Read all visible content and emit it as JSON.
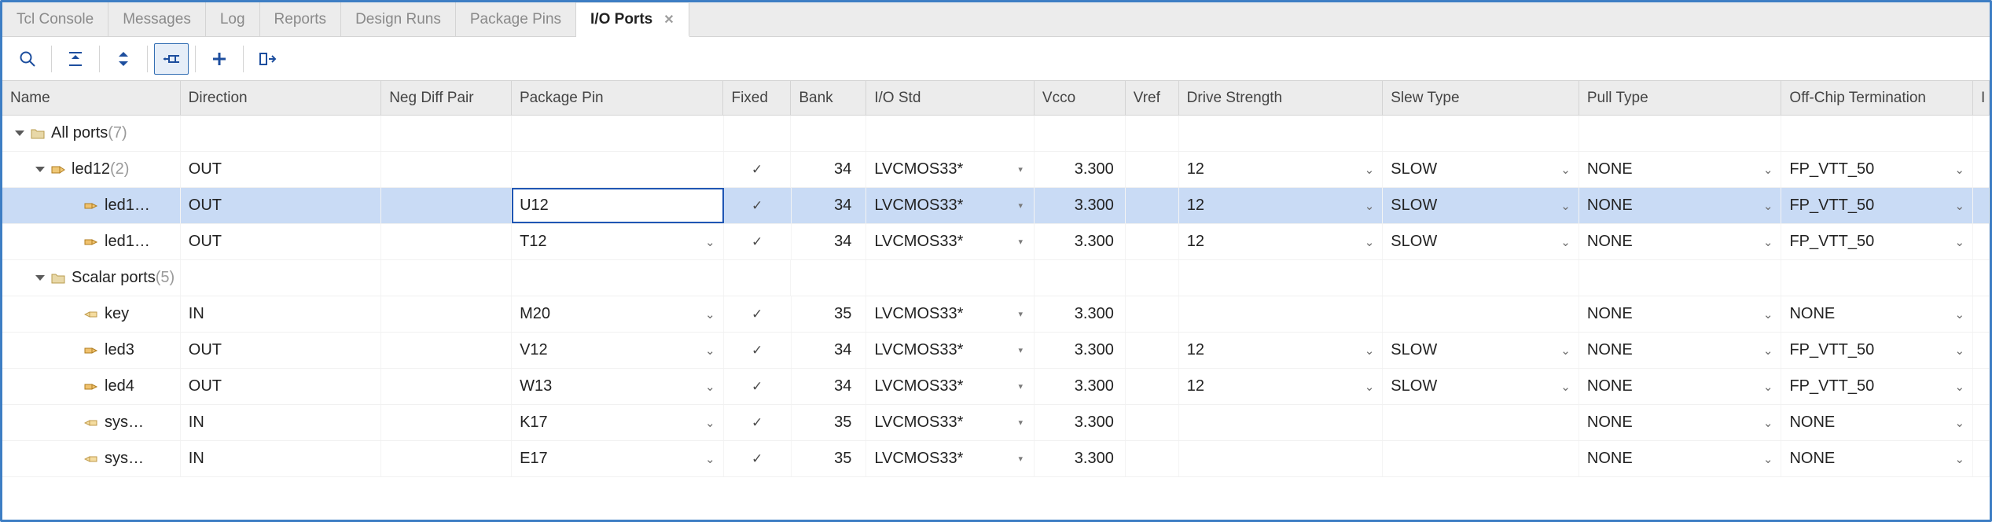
{
  "tabs": {
    "items": [
      "Tcl Console",
      "Messages",
      "Log",
      "Reports",
      "Design Runs",
      "Package Pins",
      "I/O Ports"
    ],
    "activeIndex": 6
  },
  "columns": {
    "name": "Name",
    "direction": "Direction",
    "neg": "Neg Diff Pair",
    "pkg": "Package Pin",
    "fixed": "Fixed",
    "bank": "Bank",
    "io": "I/O Std",
    "vcco": "Vcco",
    "vref": "Vref",
    "drive": "Drive Strength",
    "slew": "Slew Type",
    "pull": "Pull Type",
    "off": "Off-Chip Termination",
    "last": "I"
  },
  "tree": {
    "root": {
      "label": "All ports",
      "count": "(7)"
    },
    "groups": [
      {
        "type": "bus",
        "label": "led12",
        "count": "(2)",
        "dir": "OUT",
        "pkg": "",
        "fixed": true,
        "bank": "34",
        "io": "LVCMOS33*",
        "vcco": "3.300",
        "drive": "12",
        "slew": "SLOW",
        "pull": "NONE",
        "off": "FP_VTT_50",
        "children": [
          {
            "selected": true,
            "icon": "out",
            "label": "led1…",
            "dir": "OUT",
            "pkg": "U12",
            "fixed": true,
            "bank": "34",
            "io": "LVCMOS33*",
            "vcco": "3.300",
            "drive": "12",
            "slew": "SLOW",
            "pull": "NONE",
            "off": "FP_VTT_50"
          },
          {
            "icon": "out",
            "label": "led1…",
            "dir": "OUT",
            "pkg": "T12",
            "fixed": true,
            "bank": "34",
            "io": "LVCMOS33*",
            "vcco": "3.300",
            "drive": "12",
            "slew": "SLOW",
            "pull": "NONE",
            "off": "FP_VTT_50"
          }
        ]
      },
      {
        "type": "folder",
        "label": "Scalar ports",
        "count": "(5)",
        "children": [
          {
            "icon": "in",
            "label": "key",
            "dir": "IN",
            "pkg": "M20",
            "fixed": true,
            "bank": "35",
            "io": "LVCMOS33*",
            "vcco": "3.300",
            "drive": "",
            "slew": "",
            "pull": "NONE",
            "off": "NONE"
          },
          {
            "icon": "out",
            "label": "led3",
            "dir": "OUT",
            "pkg": "V12",
            "fixed": true,
            "bank": "34",
            "io": "LVCMOS33*",
            "vcco": "3.300",
            "drive": "12",
            "slew": "SLOW",
            "pull": "NONE",
            "off": "FP_VTT_50"
          },
          {
            "icon": "out",
            "label": "led4",
            "dir": "OUT",
            "pkg": "W13",
            "fixed": true,
            "bank": "34",
            "io": "LVCMOS33*",
            "vcco": "3.300",
            "drive": "12",
            "slew": "SLOW",
            "pull": "NONE",
            "off": "FP_VTT_50"
          },
          {
            "icon": "in",
            "label": "sys…",
            "dir": "IN",
            "pkg": "K17",
            "fixed": true,
            "bank": "35",
            "io": "LVCMOS33*",
            "vcco": "3.300",
            "drive": "",
            "slew": "",
            "pull": "NONE",
            "off": "NONE"
          },
          {
            "icon": "in",
            "label": "sys…",
            "dir": "IN",
            "pkg": "E17",
            "fixed": true,
            "bank": "35",
            "io": "LVCMOS33*",
            "vcco": "3.300",
            "drive": "",
            "slew": "",
            "pull": "NONE",
            "off": "NONE"
          }
        ]
      }
    ]
  }
}
